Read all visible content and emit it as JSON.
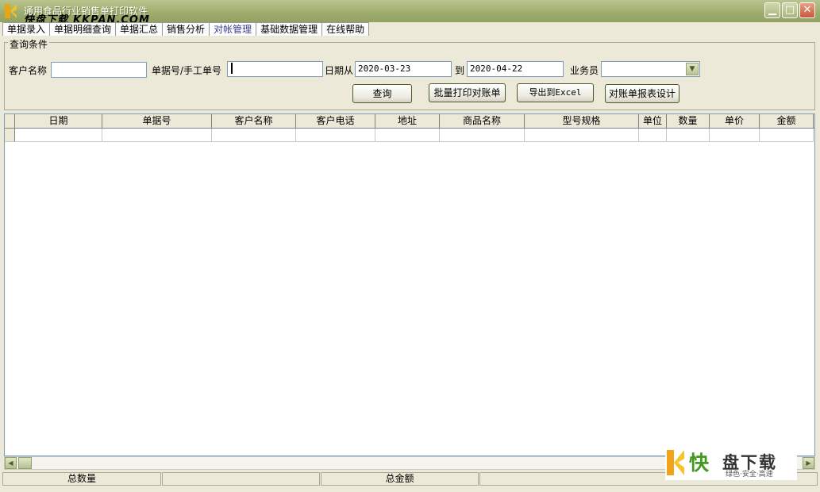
{
  "window": {
    "title": "通用食品行业销售单打印软件",
    "watermark_brand": "快盘下载",
    "watermark_url": "KKPAN.COM"
  },
  "tabs": [
    {
      "label": "单据录入"
    },
    {
      "label": "单据明细查询"
    },
    {
      "label": "单据汇总"
    },
    {
      "label": "销售分析"
    },
    {
      "label": "对帐管理",
      "active": true
    },
    {
      "label": "基础数据管理"
    },
    {
      "label": "在线帮助"
    }
  ],
  "query": {
    "group_title": "查询条件",
    "customer_label": "客户名称",
    "customer_value": "",
    "doc_label": "单据号/手工单号",
    "doc_value": "",
    "date_from_label": "日期从",
    "date_from": "2020-03-23",
    "date_to_label": "到",
    "date_to": "2020-04-22",
    "salesman_label": "业务员",
    "salesman_value": "",
    "buttons": {
      "search": "查询",
      "batch_print": "批量打印对账单",
      "export_excel": "导出到Excel",
      "report_design": "对账单报表设计"
    }
  },
  "grid": {
    "columns": [
      "日期",
      "单据号",
      "客户名称",
      "客户电话",
      "地址",
      "商品名称",
      "型号规格",
      "单位",
      "数量",
      "单价",
      "金额"
    ]
  },
  "status": {
    "total_qty_label": "总数量",
    "total_amount_label": "总金额"
  },
  "logo": {
    "big1": "快",
    "big2": "盘下载",
    "slogan": "绿色·安全·高速"
  },
  "colors": {
    "titlebar": "#9FAE6E",
    "background": "#ECE9D8",
    "active_tab_text": "#3A3F8C",
    "logo_green": "#3f9a1e"
  }
}
